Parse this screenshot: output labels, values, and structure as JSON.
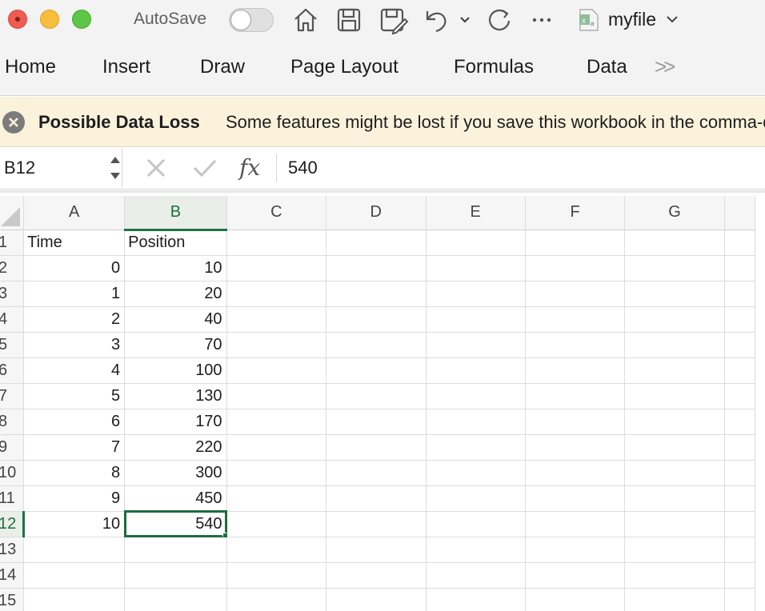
{
  "titlebar": {
    "autosave_label": "AutoSave",
    "autosave_on": false,
    "file_name": "myfile",
    "icons": [
      "home-icon",
      "save-icon",
      "save-as-icon",
      "undo-icon",
      "redo-icon",
      "more-icon",
      "excel-file-icon"
    ]
  },
  "ribbon": {
    "tabs": [
      "Home",
      "Insert",
      "Draw",
      "Page Layout",
      "Formulas",
      "Data"
    ],
    "more": ">>"
  },
  "warning": {
    "title": "Possible Data Loss",
    "message": "Some features might be lost if you save this workbook in the comma-delimited (.csv) format."
  },
  "formula_bar": {
    "name_box": "B12",
    "fx": "fx",
    "value": "540"
  },
  "sheet": {
    "columns": [
      "A",
      "B",
      "C",
      "D",
      "E",
      "F",
      "G"
    ],
    "selected_column": "B",
    "selected_row": "12",
    "rows": [
      {
        "n": "1",
        "a": "Time",
        "b": "Position"
      },
      {
        "n": "2",
        "a": "0",
        "b": "10"
      },
      {
        "n": "3",
        "a": "1",
        "b": "20"
      },
      {
        "n": "4",
        "a": "2",
        "b": "40"
      },
      {
        "n": "5",
        "a": "3",
        "b": "70"
      },
      {
        "n": "6",
        "a": "4",
        "b": "100"
      },
      {
        "n": "7",
        "a": "5",
        "b": "130"
      },
      {
        "n": "8",
        "a": "6",
        "b": "170"
      },
      {
        "n": "9",
        "a": "7",
        "b": "220"
      },
      {
        "n": "10",
        "a": "8",
        "b": "300"
      },
      {
        "n": "11",
        "a": "9",
        "b": "450"
      },
      {
        "n": "12",
        "a": "10",
        "b": "540"
      },
      {
        "n": "13",
        "a": "",
        "b": ""
      },
      {
        "n": "14",
        "a": "",
        "b": ""
      },
      {
        "n": "15",
        "a": "",
        "b": ""
      }
    ]
  },
  "colors": {
    "excel_green": "#1f7244",
    "warning_bg": "#fbf2db"
  }
}
